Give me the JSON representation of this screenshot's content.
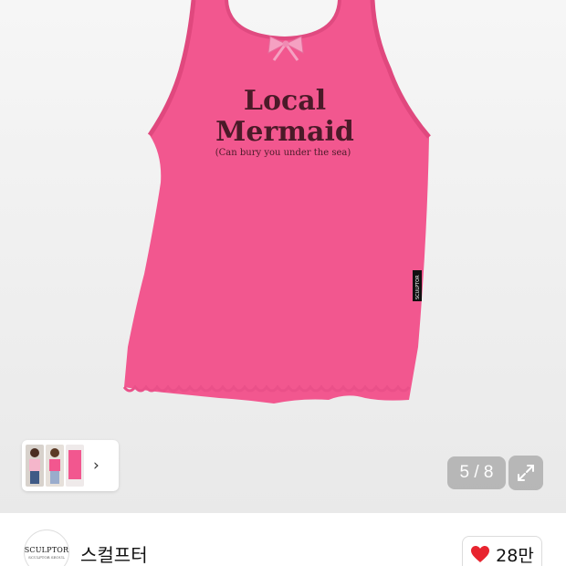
{
  "product": {
    "shirt_title_line1": "Local",
    "shirt_title_line2": "Mermaid",
    "shirt_tagline": "(Can bury you under the sea)",
    "shirt_tag": "SCULPTOR",
    "shirt_color": "#f2578f"
  },
  "gallery": {
    "page_counter": "5 / 8",
    "next_icon": "chevron-right-icon",
    "expand_icon": "expand-icon"
  },
  "seller": {
    "logo_text": "SCULPTOR",
    "logo_sub": "SCULPTOR SEOUL",
    "name": "스컬프터"
  },
  "likes": {
    "count": "28만",
    "icon": "heart-icon",
    "icon_color": "#e8242f"
  }
}
